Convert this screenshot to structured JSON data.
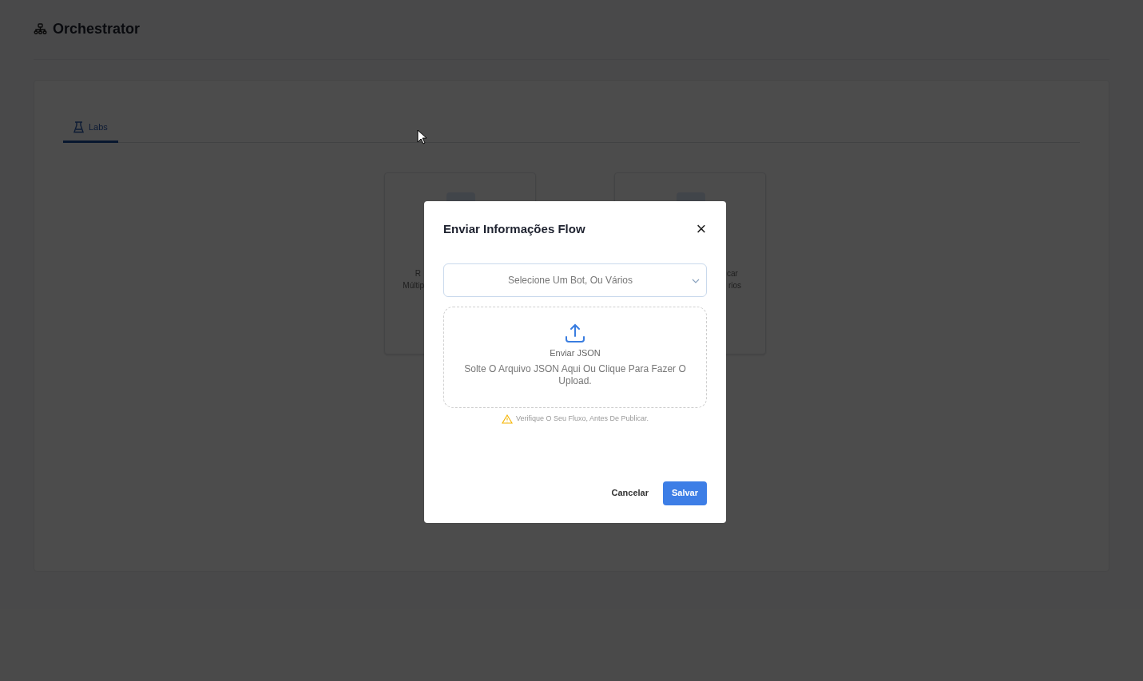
{
  "header": {
    "title": "Orchestrator"
  },
  "tabs": [
    {
      "label": "Labs",
      "selected": true
    }
  ],
  "cards": [
    {
      "lines": [
        "R",
        "Múltip"
      ]
    },
    {
      "lines": [
        "car",
        "rios"
      ]
    }
  ],
  "modal": {
    "title": "Enviar Informações Flow",
    "close": "×",
    "select": {
      "placeholder": "Selecione Um Bot, Ou Vários"
    },
    "upload": {
      "title": "Enviar JSON",
      "hint": "Solte O Arquivo JSON Aqui Ou Clique Para Fazer O Upload."
    },
    "warning": "Verifique O Seu Fluxo, Antes De Publicar.",
    "buttons": [
      {
        "label": "Cancelar",
        "kind": "secondary"
      },
      {
        "label": "Salvar",
        "kind": "primary"
      }
    ]
  }
}
